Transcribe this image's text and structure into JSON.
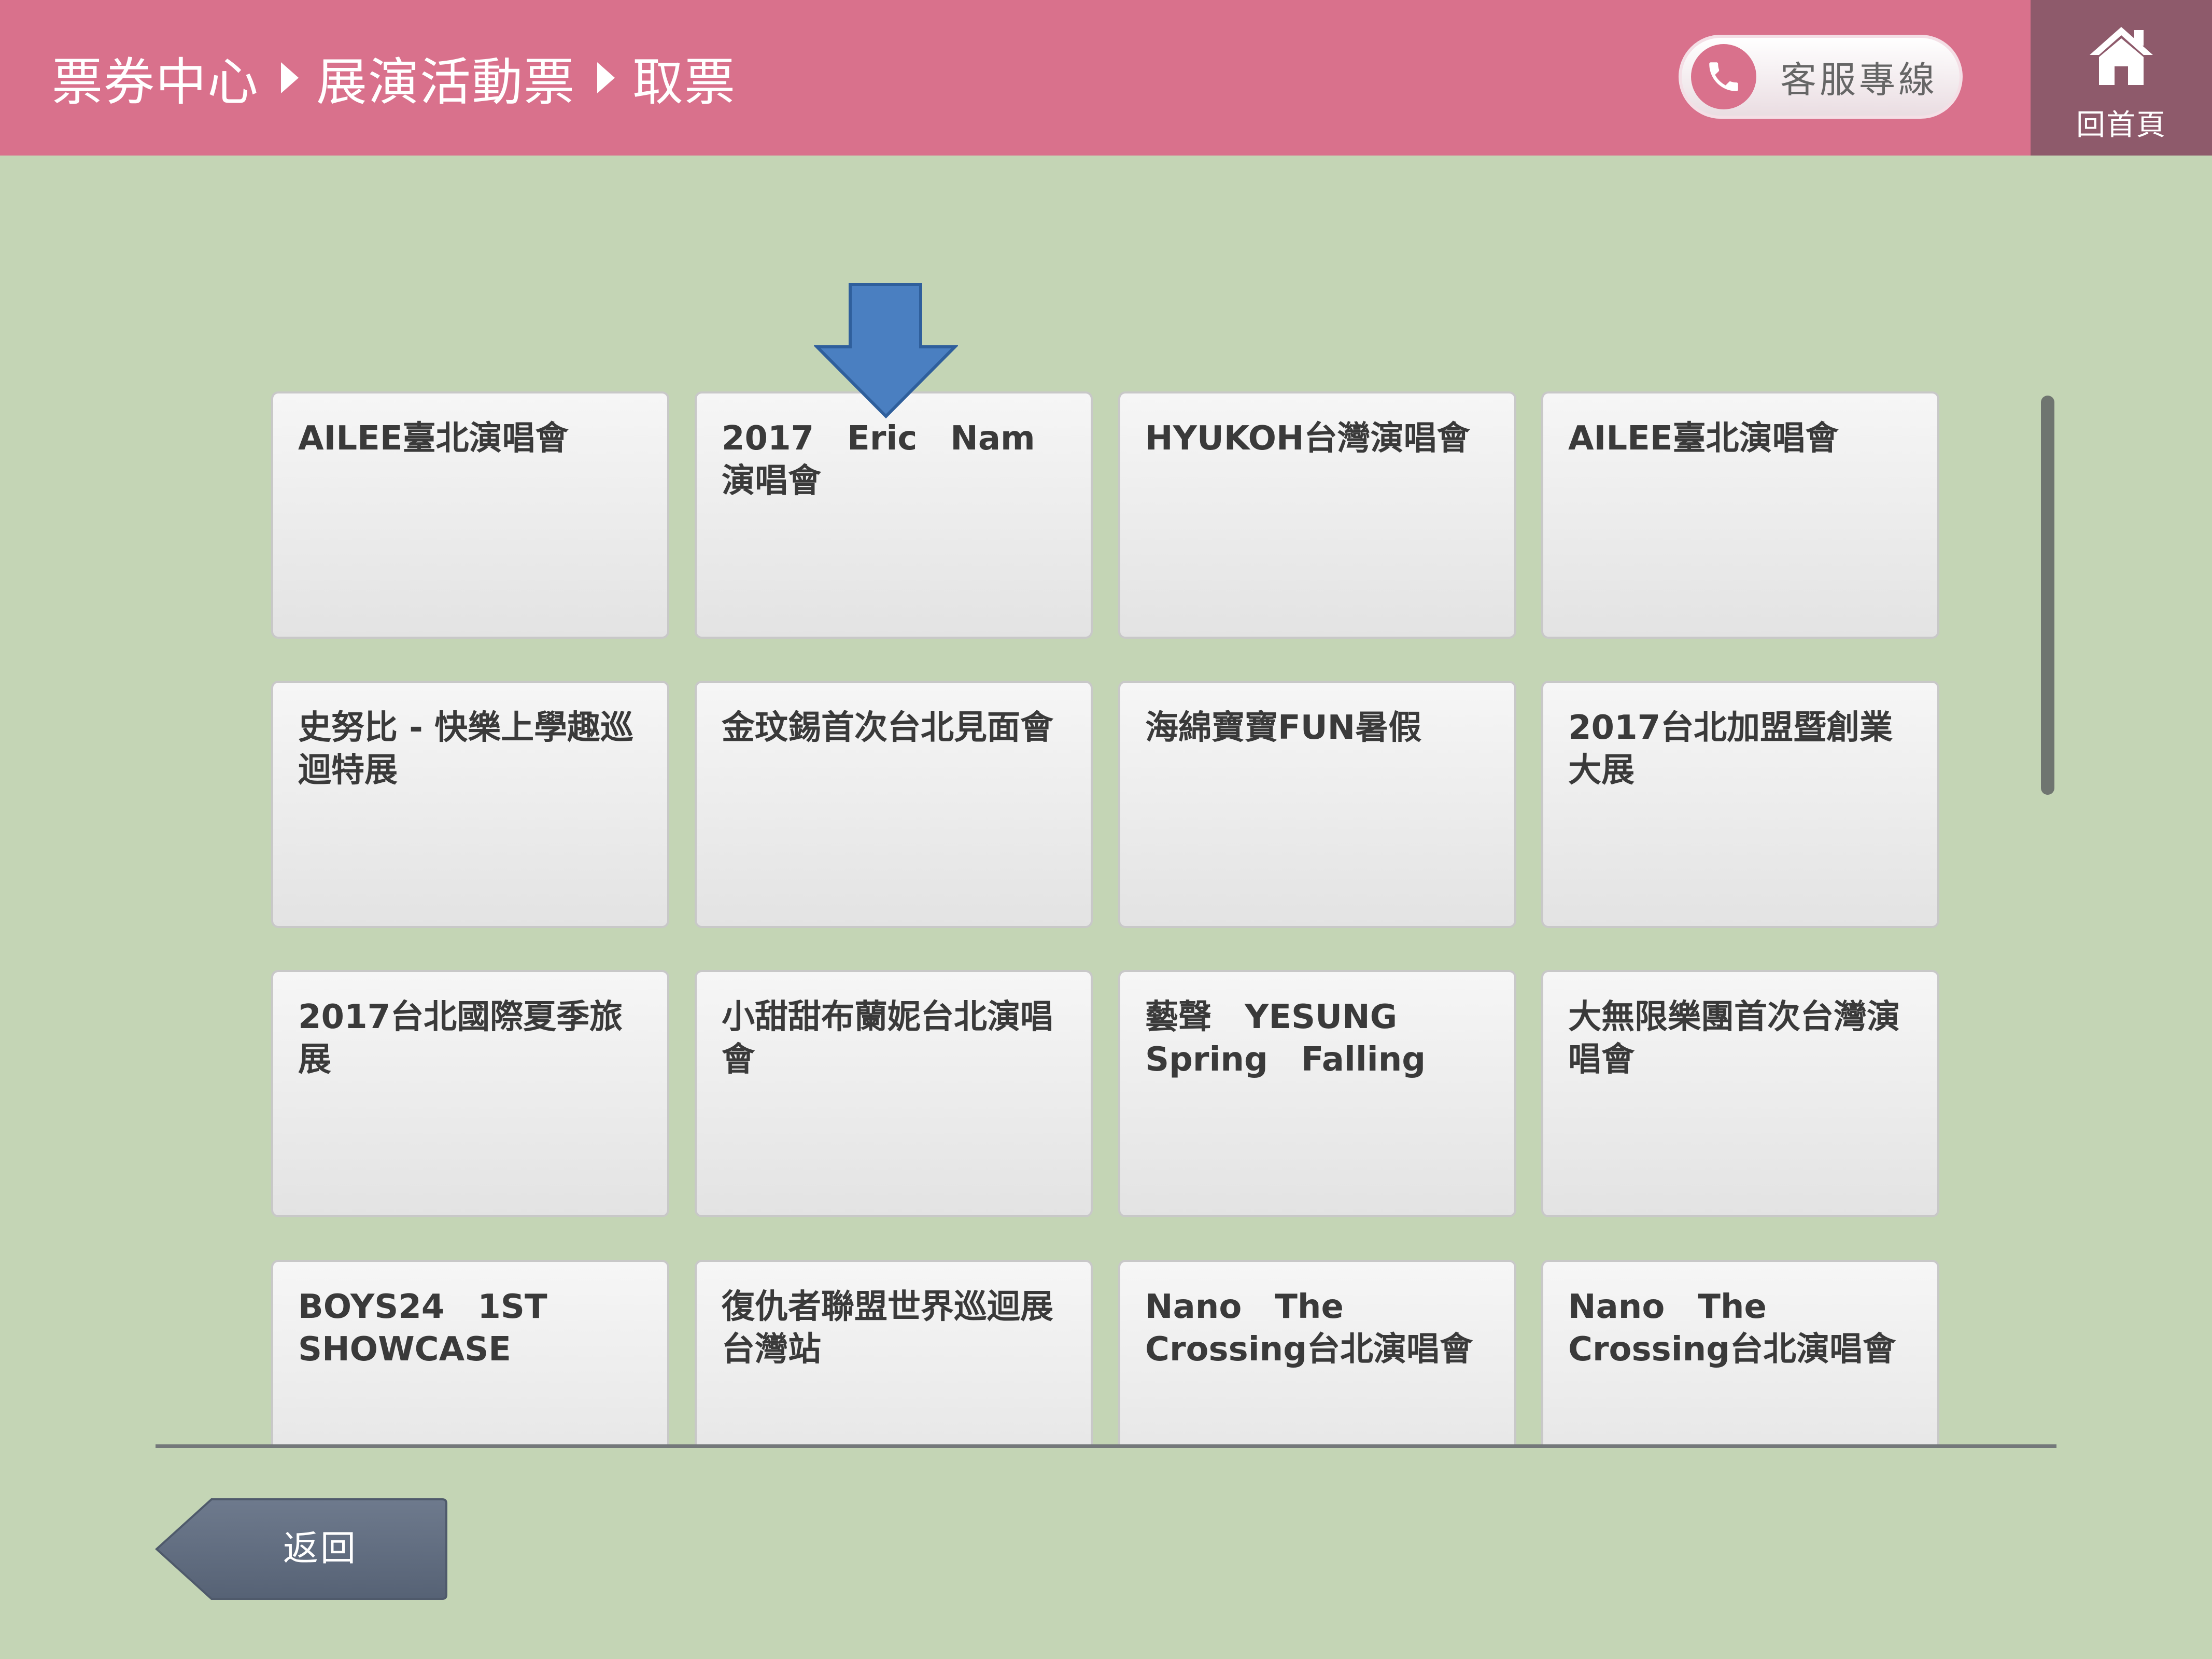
{
  "header": {
    "breadcrumb": [
      "票券中心",
      "展演活動票",
      "取票"
    ],
    "service_label": "客服專線",
    "home_label": "回首頁"
  },
  "events": [
    "AILEE臺北演唱會",
    "2017　Eric　Nam演唱會",
    "HYUKOH台灣演唱會",
    "AILEE臺北演唱會",
    "史努比 - 快樂上學趣巡迴特展",
    "金玟錫首次台北見面會",
    "海綿寶寶FUN暑假",
    "2017台北加盟暨創業大展",
    "2017台北國際夏季旅展",
    "小甜甜布蘭妮台北演唱會",
    "藝聲　YESUNG\nSpring　Falling",
    "大無限樂團首次台灣演唱會",
    "BOYS24　1ST\nSHOWCASE",
    "復仇者聯盟世界巡迴展　台灣站",
    "Nano　The\nCrossing台北演唱會",
    "Nano　The\nCrossing台北演唱會"
  ],
  "back_label": "返回",
  "colors": {
    "header_bg": "#d9718c",
    "home_bg": "#8e5a6b",
    "page_bg": "#c4d5b5",
    "arrow": "#4a7fc1",
    "back_button": "#5f6b7d"
  },
  "icons": {
    "service": "phone-icon",
    "home": "home-icon",
    "pointer": "arrow-down-icon"
  }
}
